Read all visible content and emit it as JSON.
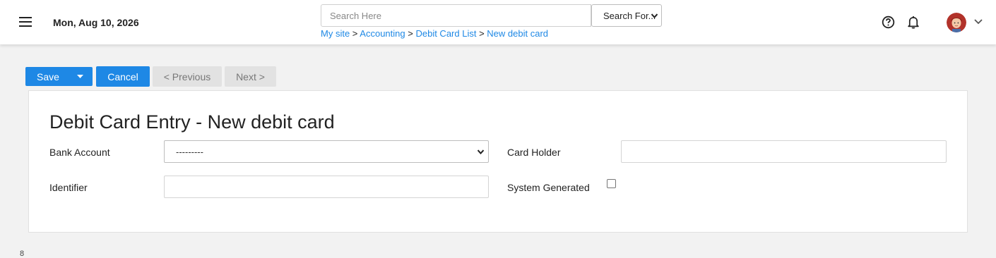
{
  "header": {
    "date": "Mon, Aug 10, 2026",
    "search": {
      "placeholder": "Search Here",
      "value": ""
    },
    "search_for": {
      "selected": "Search For..."
    },
    "breadcrumb": [
      {
        "label": "My site"
      },
      {
        "label": "Accounting"
      },
      {
        "label": "Debit Card List"
      },
      {
        "label": "New debit card"
      }
    ],
    "separator": ">"
  },
  "toolbar": {
    "save_label": "Save",
    "cancel_label": "Cancel",
    "previous_label": "< Previous",
    "next_label": "Next >"
  },
  "form": {
    "title": "Debit Card Entry - New debit card",
    "bank_account": {
      "label": "Bank Account",
      "selected": "---------"
    },
    "card_holder": {
      "label": "Card Holder",
      "value": ""
    },
    "identifier": {
      "label": "Identifier",
      "value": ""
    },
    "system_generated": {
      "label": "System Generated",
      "checked": false
    }
  },
  "footer": {
    "mark": "8"
  },
  "colors": {
    "accent": "#1e88e5",
    "background": "#f2f2f2",
    "disabled_button": "#e2e2e2"
  }
}
